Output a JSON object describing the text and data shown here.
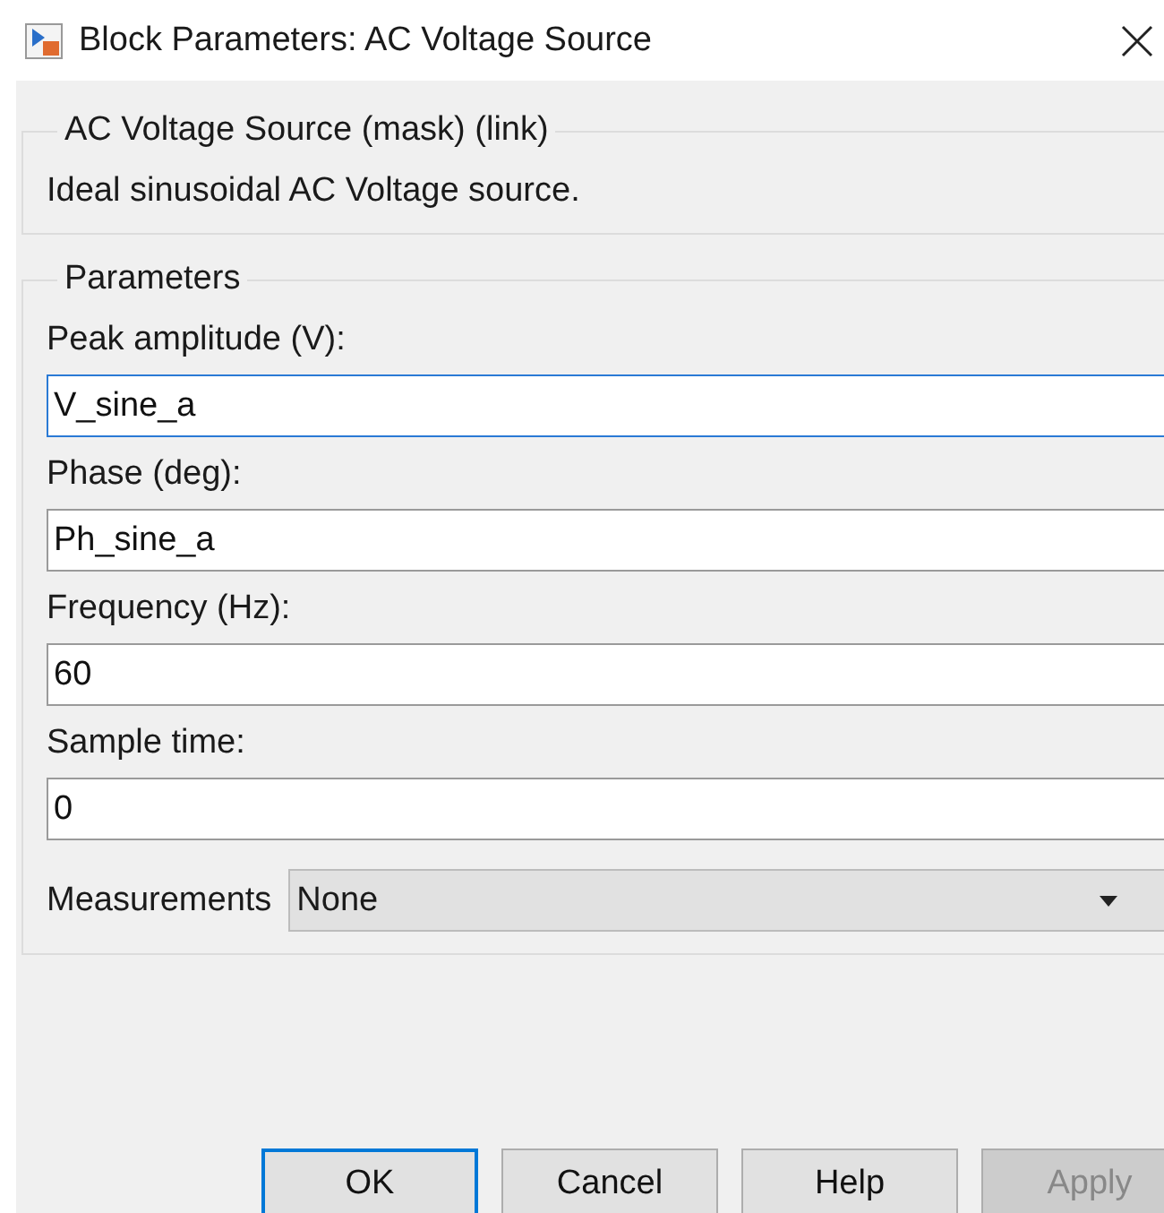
{
  "window": {
    "title": "Block Parameters: AC Voltage Source"
  },
  "mask": {
    "legend": "AC Voltage Source (mask) (link)",
    "description": "Ideal sinusoidal AC Voltage source."
  },
  "parameters": {
    "legend": "Parameters",
    "fields": [
      {
        "label": "Peak amplitude (V):",
        "value": "V_sine_a",
        "focused": true
      },
      {
        "label": "Phase (deg):",
        "value": "Ph_sine_a",
        "focused": false
      },
      {
        "label": "Frequency (Hz):",
        "value": "60",
        "focused": false
      },
      {
        "label": "Sample time:",
        "value": "0",
        "focused": false
      }
    ],
    "measurements": {
      "label": "Measurements",
      "value": "None"
    }
  },
  "buttons": [
    {
      "label": "OK",
      "focused": true,
      "disabled": false
    },
    {
      "label": "Cancel",
      "focused": false,
      "disabled": false
    },
    {
      "label": "Help",
      "focused": false,
      "disabled": false
    },
    {
      "label": "Apply",
      "focused": false,
      "disabled": true
    }
  ]
}
